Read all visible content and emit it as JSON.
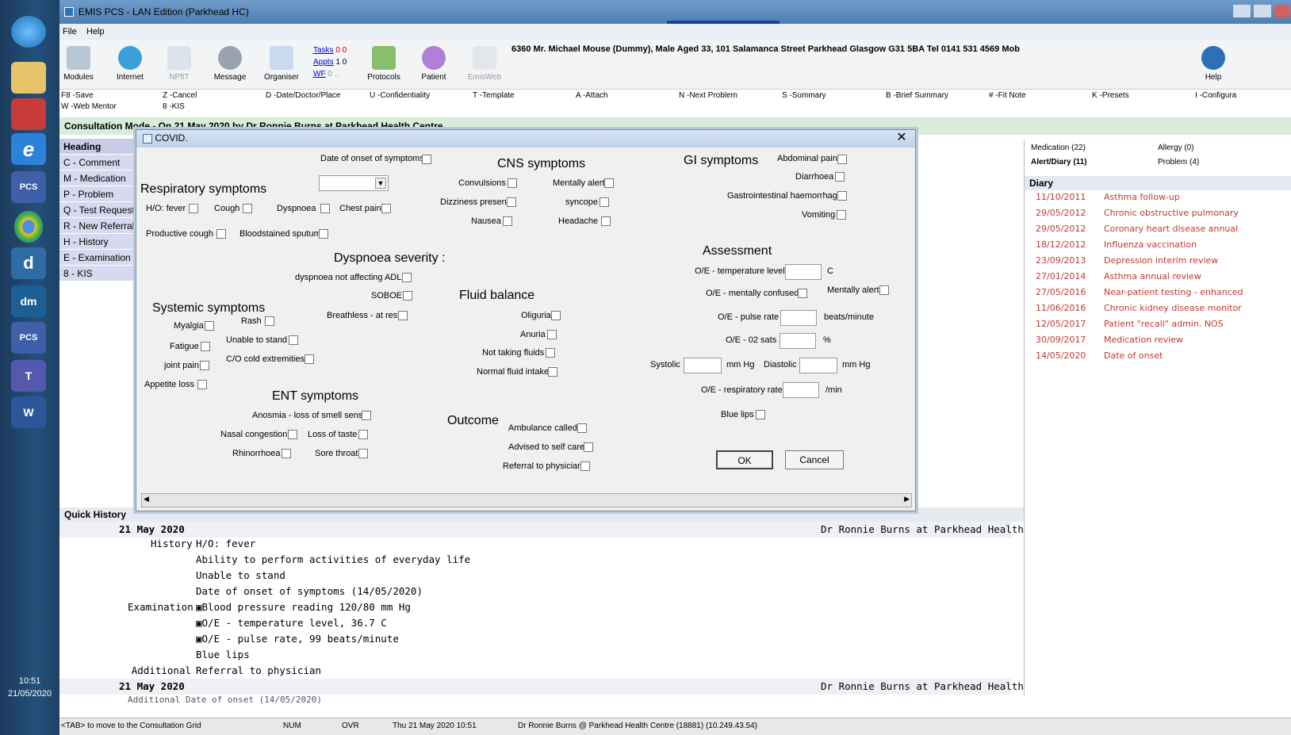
{
  "window": {
    "title": "EMIS PCS - LAN Edition (Parkhead HC)",
    "menu": [
      "File",
      "Help"
    ]
  },
  "toolbar": {
    "items": [
      "Modules",
      "Internet",
      "NPfIT",
      "Message",
      "Organiser",
      "Protocols",
      "Patient",
      "EmisWeb",
      "Help"
    ],
    "links": {
      "tasks": "Tasks",
      "appts": "Appts",
      "wf": "WF",
      "tasks_counts": "0  0",
      "appts_counts": "1  0",
      "wf_counts": "0  .."
    },
    "patient_banner": "6360 Mr. Michael Mouse (Dummy), Male Aged 33, 101 Salamanca Street Parkhead Glasgow G31 5BA Tel 0141 531 4569 Mob"
  },
  "shortcuts": [
    "F8 -Save",
    "W -Web Mentor",
    "Z -Cancel",
    "8 -KIS",
    "D -Date/Doctor/Place",
    "U -Confidentiality",
    "T -Template",
    "A -Attach",
    "N -Next Problem",
    "S -Summary",
    "B -Brief Summary",
    "# -Fit Note",
    "K -Presets",
    "I -Configura"
  ],
  "consultation": {
    "title": "Consultation Mode - On 21 May 2020 by Dr Ronnie Burns at Parkhead Health Centre"
  },
  "headings": {
    "title": "Heading",
    "items": [
      "C - Comment",
      "M - Medication",
      "P - Problem",
      "Q - Test Request",
      "R - New Referral",
      "H - History",
      "E - Examination",
      "8 - KIS"
    ]
  },
  "right_panel": {
    "tabs": [
      "Medication (22)",
      "Allergy (0)",
      "Alert/Diary (11)",
      "Problem (4)"
    ],
    "diary_title": "Diary",
    "diary": [
      {
        "date": "11/10/2011",
        "text": "Asthma follow-up"
      },
      {
        "date": "29/05/2012",
        "text": "Chronic obstructive pulmonary"
      },
      {
        "date": "29/05/2012",
        "text": "Coronary heart disease annual"
      },
      {
        "date": "18/12/2012",
        "text": "Influenza vaccination"
      },
      {
        "date": "23/09/2013",
        "text": "Depression interim review"
      },
      {
        "date": "27/01/2014",
        "text": "Asthma annual review"
      },
      {
        "date": "27/05/2016",
        "text": "Near-patient testing - enhanced"
      },
      {
        "date": "11/06/2016",
        "text": "Chronic kidney disease monitor"
      },
      {
        "date": "12/05/2017",
        "text": "Patient \"recall\" admin. NOS"
      },
      {
        "date": "30/09/2017",
        "text": "Medication review"
      },
      {
        "date": "14/05/2020",
        "text": "Date of onset"
      }
    ]
  },
  "quick_history": {
    "title": "Quick History",
    "entry_date": "21 May 2020",
    "entry_author": "Dr Ronnie Burns at Parkhead Health",
    "lines": [
      {
        "label": "History",
        "text": "H/O: fever"
      },
      {
        "label": "",
        "text": "Ability to perform activities of everyday life"
      },
      {
        "label": "",
        "text": "Unable to stand"
      },
      {
        "label": "",
        "text": "Date of onset of symptoms (14/05/2020)"
      },
      {
        "label": "Examination",
        "text": "Blood pressure reading 120/80 mm Hg"
      },
      {
        "label": "",
        "text": "O/E - temperature level, 36.7 C"
      },
      {
        "label": "",
        "text": "O/E - pulse rate, 99 beats/minute"
      },
      {
        "label": "",
        "text": "Blue lips"
      },
      {
        "label": "Additional",
        "text": "Referral to physician"
      }
    ],
    "entry2_date": "21 May 2020",
    "entry2_author": "Dr Ronnie Burns at Parkhead Health",
    "entry2_partial": "Additional  Date of onset (14/05/2020)"
  },
  "statusbar": {
    "hint": "<TAB> to move to the Consultation Grid",
    "num": "NUM",
    "ovr": "OVR",
    "datetime": "Thu 21 May 2020 10:51",
    "user": "Dr Ronnie Burns @ Parkhead Health Centre (18881) (10.249.43.54)"
  },
  "taskbar": {
    "time": "10:51",
    "date": "21/05/2020"
  },
  "dialog": {
    "title": "COVID.",
    "onset_label": "Date of onset of symptoms",
    "resp_title": "Respiratory symptoms",
    "resp": [
      "H/O: fever",
      "Cough",
      "Dyspnoea",
      "Chest pain",
      "Productive cough",
      "Bloodstained sputum"
    ],
    "cns_title": "CNS symptoms",
    "cns": [
      "Convulsions",
      "Mentally alert",
      "Dizziness present",
      "syncope",
      "Nausea",
      "Headache"
    ],
    "gi_title": "GI symptoms",
    "gi": [
      "Abdominal pain",
      "Diarrhoea",
      "Gastrointestinal haemorrhage",
      "Vomiting"
    ],
    "dysp_title": "Dyspnoea severity :",
    "dysp": [
      "dyspnoea not affecting ADL",
      "SOBOE",
      "Breathless - at rest"
    ],
    "systemic_title": "Systemic symptoms",
    "systemic": [
      "Myalgia",
      "Rash",
      "Unable to stand",
      "Fatigue",
      "joint pain",
      "C/O cold extremities",
      "Appetite loss"
    ],
    "fluid_title": "Fluid balance",
    "fluid": [
      "Oliguria",
      "Anuria",
      "Not taking fluids",
      "Normal fluid intake"
    ],
    "ent_title": "ENT symptoms",
    "ent": [
      "Anosmia - loss of smell sense",
      "Nasal congestion",
      "Loss of taste",
      "Rhinorrhoea",
      "Sore throat"
    ],
    "outcome_title": "Outcome",
    "outcome": [
      "Ambulance called",
      "Advised to self care",
      "Referral to physician"
    ],
    "assess_title": "Assessment",
    "assess": {
      "temp": "O/E - temperature level",
      "temp_unit": "C",
      "confused": "O/E - mentally confused",
      "alert": "Mentally alert",
      "pulse": "O/E - pulse rate",
      "pulse_unit": "beats/minute",
      "o2": "O/E - 02 sats",
      "o2_unit": "%",
      "systolic": "Systolic",
      "diastolic": "Diastolic",
      "mmhg": "mm Hg",
      "resp": "O/E - respiratory rate",
      "resp_unit": "/min",
      "blue_lips": "Blue lips"
    },
    "ok": "OK",
    "cancel": "Cancel"
  }
}
